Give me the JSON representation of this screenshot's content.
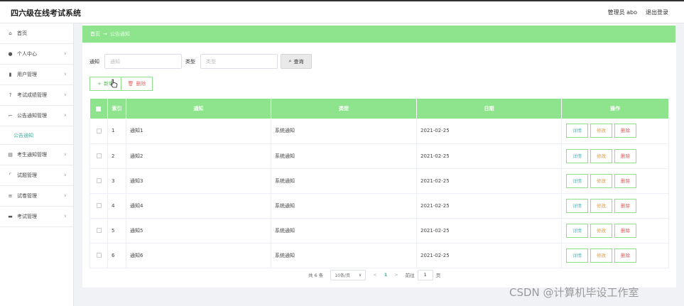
{
  "header": {
    "title": "四六级在线考试系统",
    "user_label": "管理员 abo",
    "logout_label": "退出登录"
  },
  "sidebar": {
    "items": [
      {
        "label": "首页",
        "icon": "home-icon",
        "has_chevron": false
      },
      {
        "label": "个人中心",
        "icon": "user-icon",
        "has_chevron": true
      },
      {
        "label": "用户管理",
        "icon": "chart-icon",
        "has_chevron": true
      },
      {
        "label": "考试成绩管理",
        "icon": "help-circle-icon",
        "has_chevron": true
      },
      {
        "label": "公告通知管理",
        "icon": "crop-icon",
        "has_chevron": true,
        "expanded": true
      },
      {
        "label": "考生通知管理",
        "icon": "list-icon",
        "has_chevron": true
      },
      {
        "label": "试题管理",
        "icon": "scan-icon",
        "has_chevron": true
      },
      {
        "label": "试卷管理",
        "icon": "stack-icon",
        "has_chevron": true
      },
      {
        "label": "考试管理",
        "icon": "monitor-icon",
        "has_chevron": true
      }
    ],
    "active_subitem": "公告通知"
  },
  "breadcrumb": {
    "home": "首页",
    "separator": "→",
    "current": "公告通知"
  },
  "search": {
    "notice_label": "通知",
    "notice_placeholder": "通知",
    "type_label": "类型",
    "type_placeholder": "类型",
    "query_label": "查询"
  },
  "actions": {
    "add_label": "新增",
    "delete_label": "删除"
  },
  "table": {
    "columns": [
      "索引",
      "通知",
      "类型",
      "日期",
      "操作"
    ],
    "rows": [
      {
        "index": "1",
        "notice": "通知1",
        "type": "系统通知",
        "date": "2021-02-25"
      },
      {
        "index": "2",
        "notice": "通知2",
        "type": "系统通知",
        "date": "2021-02-25"
      },
      {
        "index": "3",
        "notice": "通知3",
        "type": "系统通知",
        "date": "2021-02-25"
      },
      {
        "index": "4",
        "notice": "通知4",
        "type": "系统通知",
        "date": "2021-02-25"
      },
      {
        "index": "5",
        "notice": "通知5",
        "type": "系统通知",
        "date": "2021-02-25"
      },
      {
        "index": "6",
        "notice": "通知6",
        "type": "系统通知",
        "date": "2021-02-25"
      }
    ],
    "op_labels": {
      "detail": "详情",
      "edit": "修改",
      "remove": "删除"
    }
  },
  "pagination": {
    "total": "共 6 条",
    "page_size": "10条/页",
    "prev": "<",
    "current_page": "1",
    "next": ">",
    "goto_label": "前往",
    "goto_value": "1",
    "page_unit": "页"
  },
  "watermark": "CSDN @计算机毕设工作室",
  "colors": {
    "accent_green": "#8ee48c",
    "active_teal": "#3fb19f"
  }
}
